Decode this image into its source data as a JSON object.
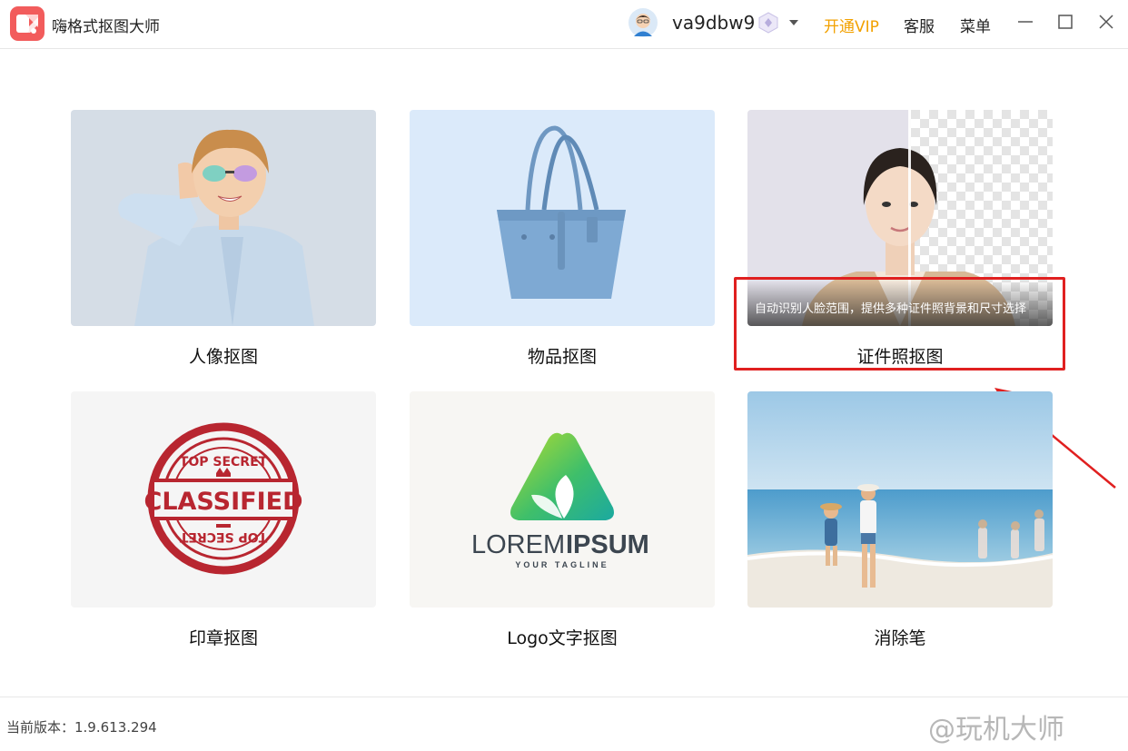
{
  "app": {
    "title": "嗨格式抠图大师"
  },
  "header": {
    "username": "va9dbw9",
    "vip_label": "开通VIP",
    "service_label": "客服",
    "menu_label": "菜单"
  },
  "cards": [
    {
      "label": "人像抠图"
    },
    {
      "label": "物品抠图"
    },
    {
      "label": "证件照抠图",
      "overlay": "自动识别人脸范围，提供多种证件照背景和尺寸选择"
    },
    {
      "label": "印章抠图"
    },
    {
      "label": "Logo文字抠图"
    },
    {
      "label": "消除笔"
    }
  ],
  "stamp": {
    "top_text": "TOP SECRET",
    "main_text": "CLASSIFIED",
    "bottom_text": "TOP SECRET"
  },
  "logo_sample": {
    "word1": "LOREM",
    "word2": "IPSUM",
    "tagline": "YOUR TAGLINE"
  },
  "footer": {
    "version": "当前版本：1.9.613.294",
    "watermark": "@玩机大师"
  },
  "colors": {
    "accent_vip": "#f2a100",
    "annotation": "#e02020",
    "brand": "#f05a5a"
  },
  "icons": [
    "app-logo-icon",
    "avatar-icon",
    "vip-badge-icon",
    "chevron-down-icon",
    "minimize-icon",
    "maximize-icon",
    "close-icon"
  ]
}
